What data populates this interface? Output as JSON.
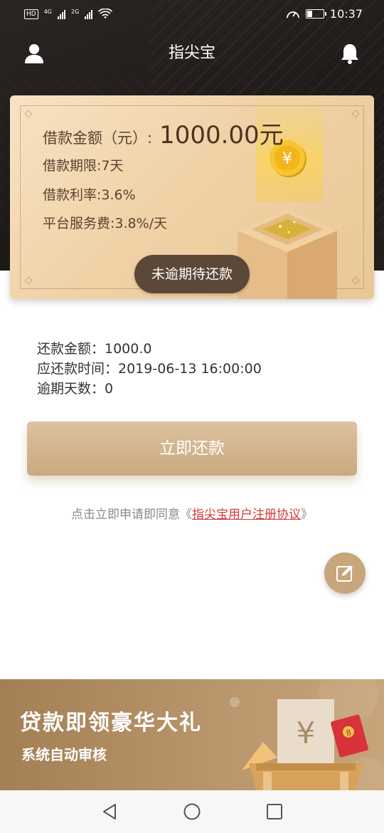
{
  "status_bar": {
    "left_badges": [
      "HD",
      "4G",
      "2G"
    ],
    "time": "10:37"
  },
  "header": {
    "title": "指尖宝",
    "left_icon": "user-icon",
    "right_icon": "bell-icon"
  },
  "loan_card": {
    "amount_label": "借款金额（元）:",
    "amount_value": "1000.00元",
    "term": "借款期限:7天",
    "rate": "借款利率:3.6%",
    "service_fee": "平台服务费:3.8%/天",
    "status": "未逾期待还款",
    "coin_symbol": "¥"
  },
  "repayment": {
    "amount": "还款金额：1000.0",
    "due_time": "应还款时间：2019-06-13 16:00:00",
    "overdue_days": "逾期天数：0"
  },
  "pay_button_label": "立即还款",
  "agreement": {
    "prefix": "点击立即申请即同意《",
    "link_text": "指尖宝用户注册协议",
    "suffix": "》"
  },
  "banner": {
    "title": "贷款即领豪华大礼",
    "subtitle": "系统自动审核",
    "yen_symbol": "¥",
    "envelope_number": "8"
  },
  "colors": {
    "gold": "#c8a67c",
    "dark": "#221d1b",
    "link_red": "#d23b3b",
    "pill": "#5b4838"
  }
}
